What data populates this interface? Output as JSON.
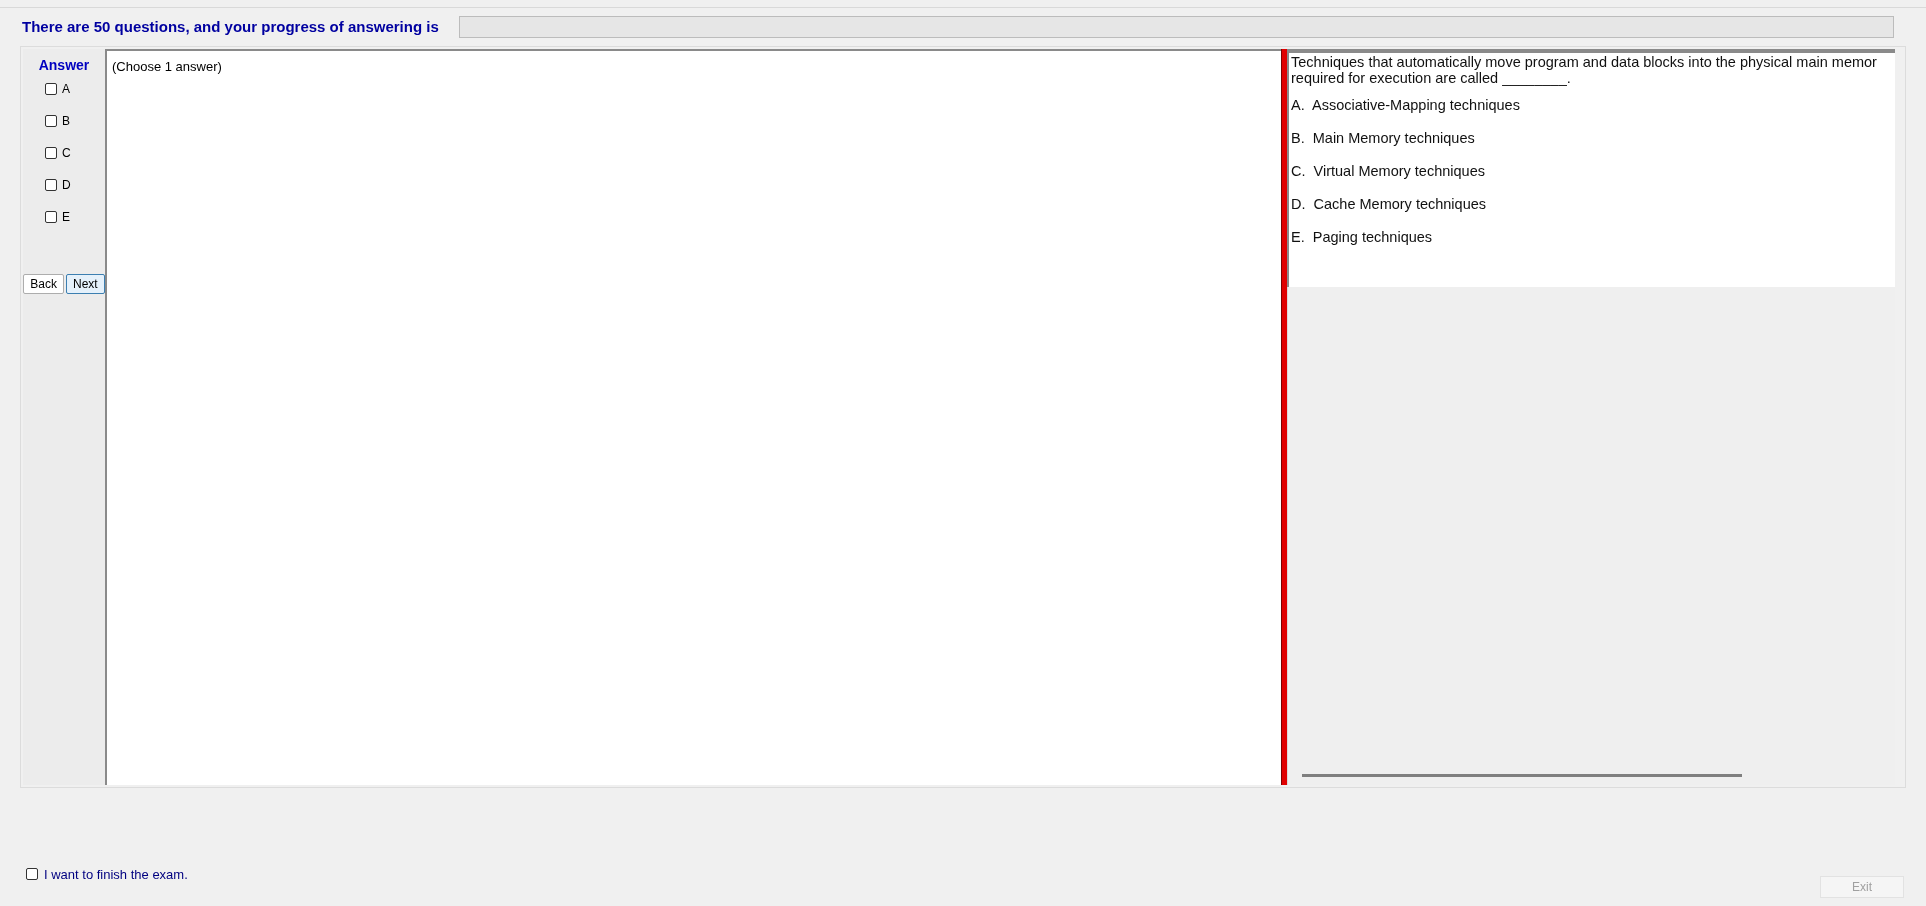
{
  "header": {
    "text": "There are 50 questions, and your progress of answering is",
    "progress": {
      "level": 0
    }
  },
  "answer_panel": {
    "title": "Answer",
    "options": [
      {
        "label": "A",
        "checked": false
      },
      {
        "label": "B",
        "checked": false
      },
      {
        "label": "C",
        "checked": false
      },
      {
        "label": "D",
        "checked": false
      },
      {
        "label": "E",
        "checked": false
      }
    ],
    "buttons": [
      {
        "label": "Back",
        "selected": false
      },
      {
        "label": "Next",
        "selected": true
      }
    ]
  },
  "answer_area": {
    "hint": "(Choose 1 answer)"
  },
  "question": {
    "text_lines": [
      "Techniques that automatically move program and data blocks into the physical main memor",
      "required for execution are called ________."
    ],
    "choices": [
      "A.  Associative-Mapping techniques",
      "B.  Main Memory techniques",
      "C.  Virtual Memory techniques",
      "D.  Cache Memory techniques",
      "E.  Paging techniques"
    ]
  },
  "footer": {
    "finish": {
      "label": "I want to finish the exam.",
      "checked": false
    },
    "exit": {
      "label": "Exit",
      "disabled": true
    }
  }
}
